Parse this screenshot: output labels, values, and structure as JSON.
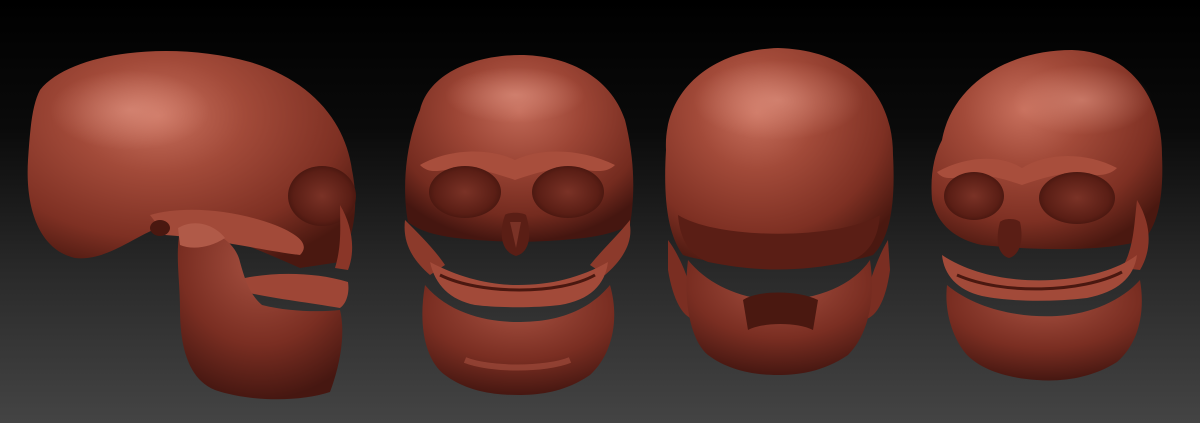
{
  "scene": {
    "background": {
      "top": "#000000",
      "bottom": "#444444"
    },
    "material": {
      "base": "#8f3a2c",
      "highlight": "#c46a58",
      "shadow": "#4a1810",
      "cavity": "#3a110b"
    },
    "views": [
      {
        "id": "side",
        "label": ""
      },
      {
        "id": "front",
        "label": ""
      },
      {
        "id": "back",
        "label": ""
      },
      {
        "id": "three-quarter",
        "label": ""
      }
    ]
  }
}
